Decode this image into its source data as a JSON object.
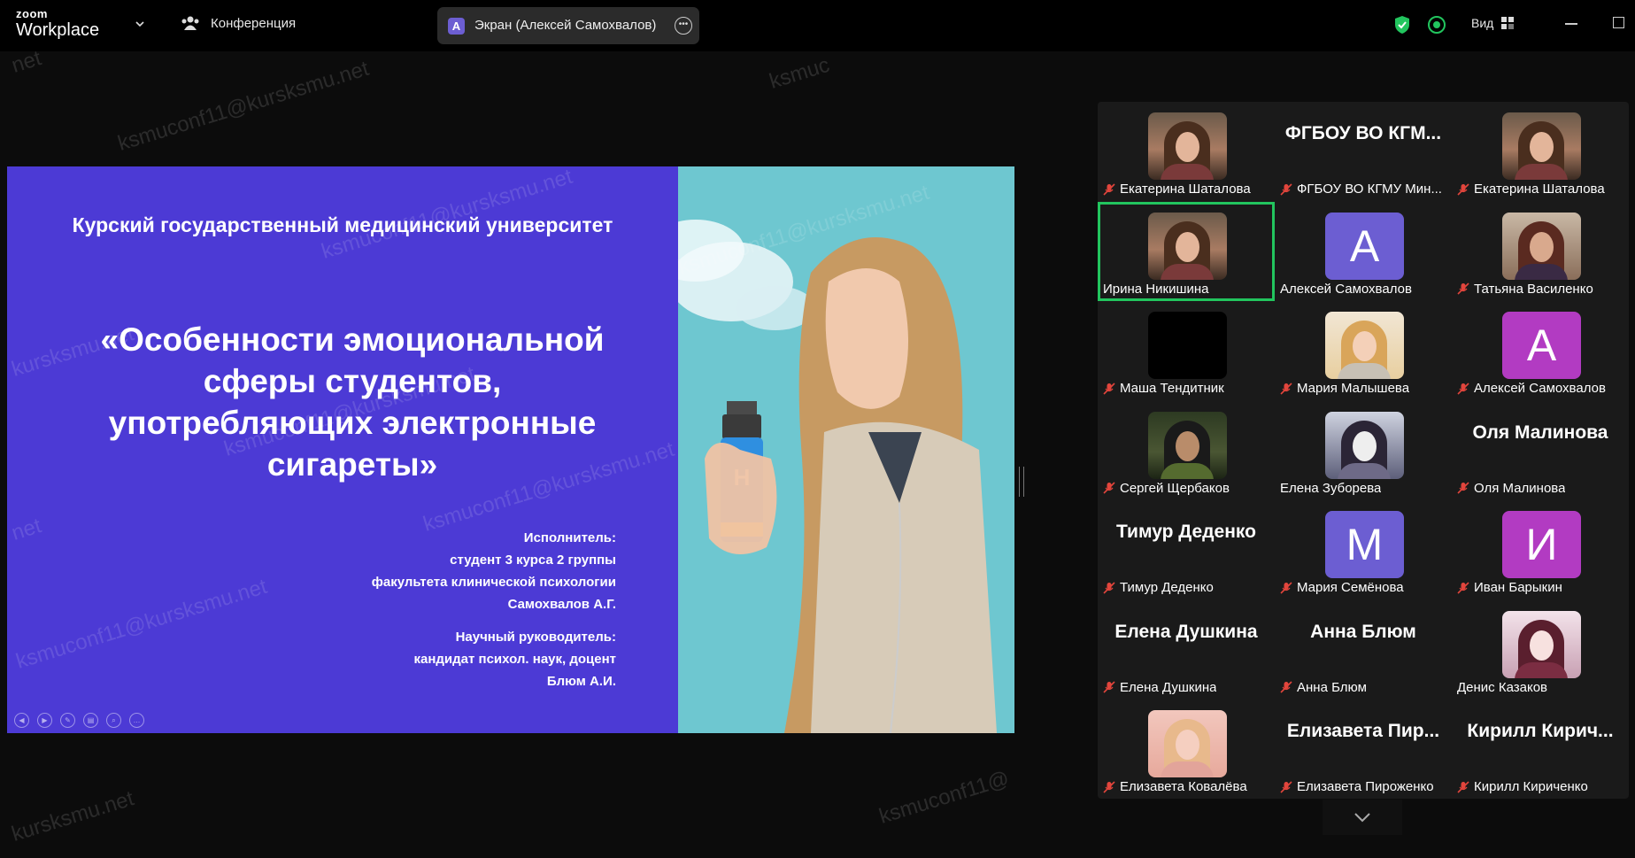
{
  "app": {
    "logo_top": "zoom",
    "logo_bottom": "Workplace",
    "meeting_label": "Конференция",
    "share_initial": "A",
    "share_label": "Экран (Алексей Самохвалов)",
    "view_label": "Вид",
    "accent_green": "#22c55e",
    "mic_muted_color": "#e2453c"
  },
  "watermarks": [
    "ksmuconf11@kursksmu.net",
    "ksmuc",
    "net",
    "ksmuconf11@kursksmu.net",
    "ksmuconf11@kursksmu.net",
    "kursksmu.net",
    "ksmuconf11@kursksmu.net",
    "ksmuconf11@kursksmu.net",
    "ksmuconf11@kursksmu.net",
    "ksmuconf11@",
    "kursksmu.net",
    "net"
  ],
  "slide": {
    "university": "Курский государственный медицинский университет",
    "title_lines": [
      "«Особенности эмоциональной",
      "сферы студентов,",
      "употребляющих электронные",
      "сигареты»"
    ],
    "author_lines": [
      "Исполнитель:",
      "студент 3 курса 2 группы",
      "факультета клинической психологии",
      "Самохвалов А.Г."
    ],
    "supervisor_lines": [
      "Научный руководитель:",
      "кандидат психол. наук, доцент",
      "Блюм А.И."
    ],
    "vape_letter": "H"
  },
  "participants": [
    {
      "name": "Екатерина Шаталова",
      "thumb": "photo",
      "muted": true
    },
    {
      "name": "ФГБОУ ВО КГМУ Мин...",
      "big": "ФГБОУ ВО КГМ...",
      "thumb": "none",
      "muted": true
    },
    {
      "name": "Екатерина Шаталова",
      "thumb": "photo",
      "muted": true
    },
    {
      "name": "Ирина Никишина",
      "thumb": "photo",
      "muted": false,
      "active": true
    },
    {
      "name": "Алексей Самохвалов",
      "initial": "A",
      "thumb": "purple",
      "muted": false
    },
    {
      "name": "Татьяна Василенко",
      "thumb": "older",
      "muted": true
    },
    {
      "name": "Маша Тендитник",
      "thumb": "dark",
      "muted": true
    },
    {
      "name": "Мария Малышева",
      "thumb": "blond",
      "muted": true
    },
    {
      "name": "Алексей Самохвалов",
      "initial": "A",
      "thumb": "magenta",
      "muted": true
    },
    {
      "name": "Сергей Щербаков",
      "thumb": "camo",
      "muted": true
    },
    {
      "name": "Елена Зуборева",
      "thumb": "anime",
      "muted": false
    },
    {
      "name": "Оля Малинова",
      "big": "Оля Малинова",
      "thumb": "none",
      "muted": true
    },
    {
      "name": "Тимур Деденко",
      "big": "Тимур Деденко",
      "thumb": "none",
      "muted": true
    },
    {
      "name": "Мария Семёнова",
      "initial": "М",
      "thumb": "purple",
      "muted": true
    },
    {
      "name": "Иван Барыкин",
      "initial": "И",
      "thumb": "magenta",
      "muted": true
    },
    {
      "name": "Елена Душкина",
      "big": "Елена Душкина",
      "thumb": "none",
      "muted": true
    },
    {
      "name": "Анна Блюм",
      "big": "Анна Блюм",
      "thumb": "none",
      "muted": true
    },
    {
      "name": "Денис Казаков",
      "thumb": "anime2",
      "muted": false
    },
    {
      "name": "Елизавета Ковалёва",
      "thumb": "pink",
      "muted": true
    },
    {
      "name": "Елизавета Пироженко",
      "big": "Елизавета Пир...",
      "thumb": "none",
      "muted": true
    },
    {
      "name": "Кирилл Кириченко",
      "big": "Кирилл Кирич...",
      "thumb": "none",
      "muted": true
    }
  ]
}
